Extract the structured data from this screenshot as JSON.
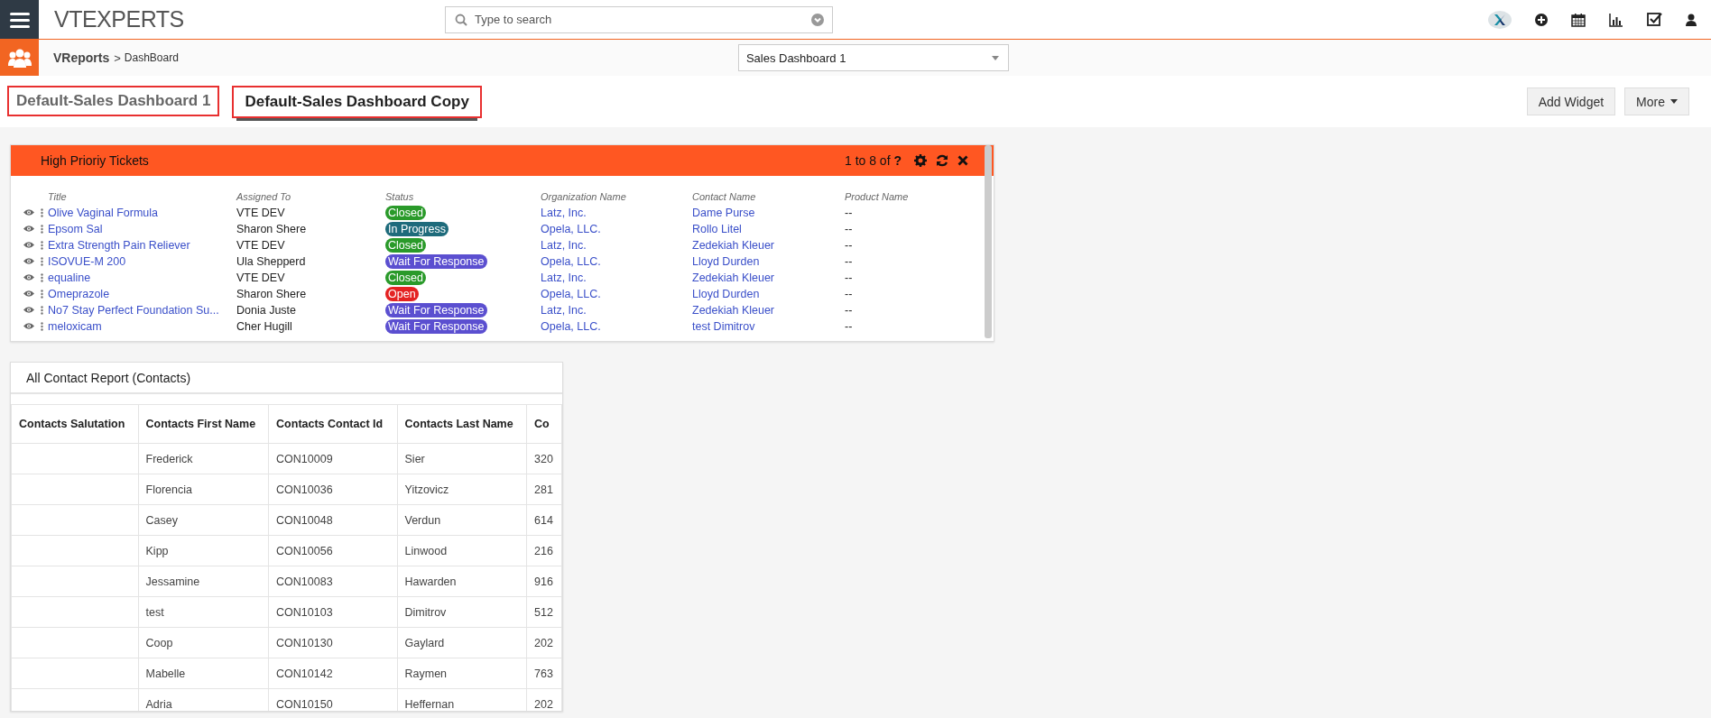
{
  "topbar": {
    "logo": "VTEXPERTS",
    "search": {
      "placeholder": "Type to search"
    }
  },
  "breadcrumb": {
    "module": "VReports",
    "separator": ">",
    "page": "DashBoard",
    "dashboard_select": "Sales Dashboard 1"
  },
  "tabs": [
    {
      "label": "Default-Sales Dashboard 1",
      "selected": false,
      "annotated": true
    },
    {
      "label": "Default-Sales Dashboard Copy",
      "selected": true,
      "annotated": true
    }
  ],
  "buttons": [
    {
      "label": "Add Widget",
      "kind": "plain"
    },
    {
      "label": "More",
      "kind": "dropdown"
    }
  ],
  "tickets_widget": {
    "title": "High Prioriy Tickets",
    "pager": "1 to 8 of **?**",
    "columns": [
      "Title",
      "Assigned To",
      "Status",
      "Organization Name",
      "Contact Name",
      "Product Name"
    ],
    "rows": [
      {
        "title": "Olive Vaginal Formula",
        "assigned_to": "VTE DEV",
        "status": {
          "label": "Closed",
          "color": "#2a9a2a"
        },
        "organization": "Latz, Inc.",
        "contact": "Dame Purse",
        "product": "--"
      },
      {
        "title": "Epsom Sal",
        "assigned_to": "Sharon Shere",
        "status": {
          "label": "In Progress",
          "color": "#1e6b7b"
        },
        "organization": "Opela, LLC.",
        "contact": "Rollo Litel",
        "product": "--"
      },
      {
        "title": "Extra Strength Pain Reliever",
        "assigned_to": "VTE DEV",
        "status": {
          "label": "Closed",
          "color": "#2a9a2a"
        },
        "organization": "Latz, Inc.",
        "contact": "Zedekiah Kleuer",
        "product": "--"
      },
      {
        "title": "ISOVUE-M 200",
        "assigned_to": "Ula Shepperd",
        "status": {
          "label": "Wait For Response",
          "color": "#5b4fd0"
        },
        "organization": "Opela, LLC.",
        "contact": "Lloyd Durden",
        "product": "--"
      },
      {
        "title": "equaline",
        "assigned_to": "VTE DEV",
        "status": {
          "label": "Closed",
          "color": "#2a9a2a"
        },
        "organization": "Latz, Inc.",
        "contact": "Zedekiah Kleuer",
        "product": "--"
      },
      {
        "title": "Omeprazole",
        "assigned_to": "Sharon Shere",
        "status": {
          "label": "Open",
          "color": "#e42222"
        },
        "organization": "Opela, LLC.",
        "contact": "Lloyd Durden",
        "product": "--"
      },
      {
        "title": "No7 Stay Perfect Foundation Su...",
        "assigned_to": "Donia Juste",
        "status": {
          "label": "Wait For Response",
          "color": "#5b4fd0"
        },
        "organization": "Latz, Inc.",
        "contact": "Zedekiah Kleuer",
        "product": "--"
      },
      {
        "title": "meloxicam",
        "assigned_to": "Cher Hugill",
        "status": {
          "label": "Wait For Response",
          "color": "#5b4fd0"
        },
        "organization": "Opela, LLC.",
        "contact": "test Dimitrov",
        "product": "--"
      }
    ]
  },
  "contacts_widget": {
    "title": "All Contact Report (Contacts)",
    "columns": [
      "Contacts Salutation",
      "Contacts First Name",
      "Contacts Contact Id",
      "Contacts Last Name",
      "Co"
    ],
    "rows": [
      [
        "",
        "Frederick",
        "CON10009",
        "Sier",
        "320"
      ],
      [
        "",
        "Florencia",
        "CON10036",
        "Yitzovicz",
        "281"
      ],
      [
        "",
        "Casey",
        "CON10048",
        "Verdun",
        "614"
      ],
      [
        "",
        "Kipp",
        "CON10056",
        "Linwood",
        "216"
      ],
      [
        "",
        "Jessamine",
        "CON10083",
        "Hawarden",
        "916"
      ],
      [
        "",
        "test",
        "CON10103",
        "Dimitrov",
        "512"
      ],
      [
        "",
        "Coop",
        "CON10130",
        "Gaylard",
        "202"
      ],
      [
        "",
        "Mabelle",
        "CON10142",
        "Raymen",
        "763"
      ],
      [
        "",
        "Adria",
        "CON10150",
        "Heffernan",
        "202"
      ]
    ]
  }
}
